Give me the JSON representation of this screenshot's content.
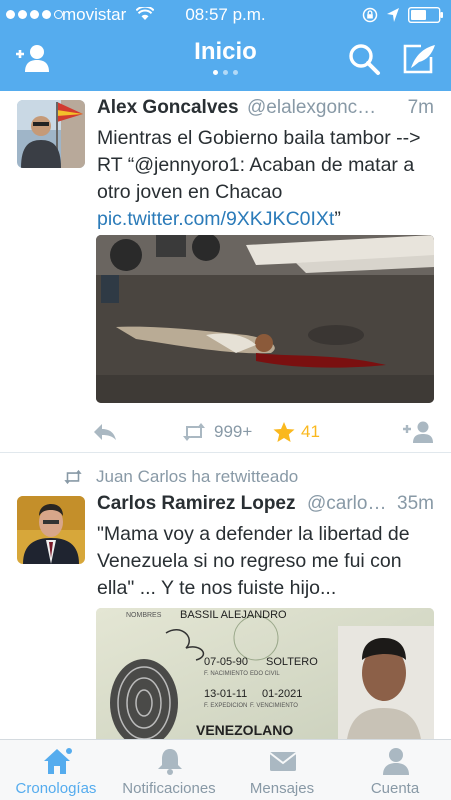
{
  "status": {
    "carrier": "movistar",
    "time": "08:57 p.m."
  },
  "nav": {
    "title": "Inicio",
    "add_user_icon": "add-user-icon",
    "search_icon": "search-icon",
    "compose_icon": "compose-icon"
  },
  "tweets": [
    {
      "name": "Alex Goncalves",
      "handle": "@elalexgoncal…",
      "age": "7m",
      "text_plain": "Mientras el Gobierno baila tambor --> RT “@jennyoro1: Acaban de matar a otro joven en Chacao ",
      "link": "pic.twitter.com/9XKJKC0IXt",
      "text_end": "”",
      "retweets": "999+",
      "favorites": "41"
    },
    {
      "retweeted_by": "Juan Carlos ha retwitteado",
      "name": "Carlos Ramirez Lopez",
      "handle": "@carlos…",
      "age": "35m",
      "text_plain": "\"Mama voy a defender la libertad de Venezuela si no regreso me fui con ella\" ... Y te nos fuiste hijo...",
      "id_card": {
        "label_name": "NOMBRES",
        "name": "BASSIL ALEJANDRO",
        "birth_date": "07-05-90",
        "marital": "SOLTERO",
        "label_birth": "F. NACIMIENTO",
        "label_civil": "EDO CIVIL",
        "issue_date": "13-01-11",
        "expiry_date": "01-2021",
        "label_issue": "F. EXPEDICION",
        "label_expiry": "F. VENCIMIENTO",
        "nationality": "VENEZOLANO"
      }
    }
  ],
  "tabs": [
    {
      "label": "Cronologías",
      "icon": "home-icon",
      "active": true
    },
    {
      "label": "Notificaciones",
      "icon": "bell-icon",
      "active": false
    },
    {
      "label": "Mensajes",
      "icon": "envelope-icon",
      "active": false
    },
    {
      "label": "Cuenta",
      "icon": "person-icon",
      "active": false
    }
  ],
  "colors": {
    "brand": "#55acee",
    "link": "#2b7bb9",
    "muted": "#8899a6",
    "favorite": "#fab81e"
  }
}
